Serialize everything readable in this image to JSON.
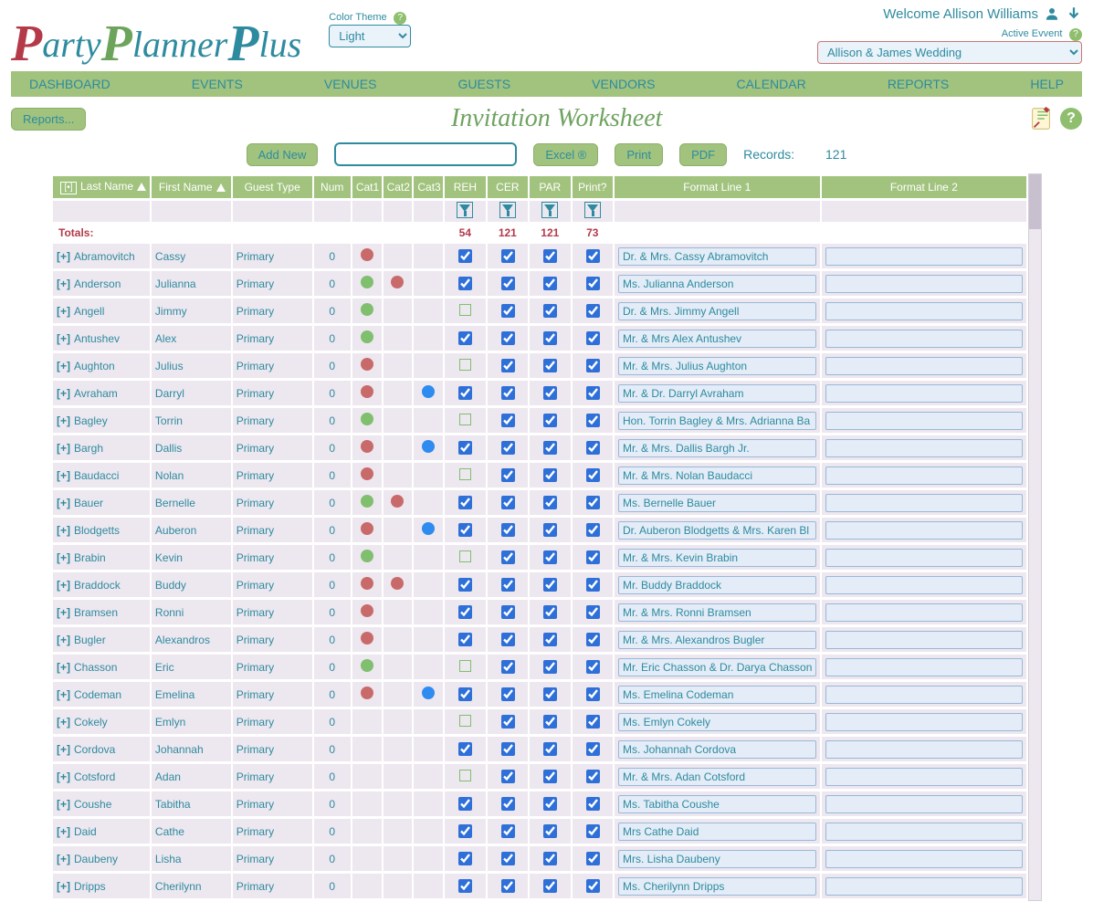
{
  "app": {
    "name_parts": [
      "P",
      "arty",
      "P",
      "lanner",
      "P",
      "lus"
    ],
    "welcome": "Welcome Allison Williams",
    "color_theme_label": "Color Theme",
    "color_theme_value": "Light",
    "active_event_label": "Active Evvent",
    "active_event_value": "Allison & James Wedding"
  },
  "nav": [
    "DASHBOARD",
    "EVENTS",
    "VENUES",
    "GUESTS",
    "VENDORS",
    "CALENDAR",
    "REPORTS",
    "HELP"
  ],
  "subbar": {
    "reports_btn": "Reports..."
  },
  "page_title": "Invitation Worksheet",
  "toolbar": {
    "add_new": "Add New",
    "search_placeholder": "",
    "excel": "Excel ®",
    "print": "Print",
    "pdf": "PDF",
    "records_label": "Records:",
    "records_count": "121"
  },
  "columns": [
    "Last Name",
    "First Name",
    "Guest Type",
    "Num",
    "Cat1",
    "Cat2",
    "Cat3",
    "REH",
    "CER",
    "PAR",
    "Print?",
    "Format Line 1",
    "Format Line 2"
  ],
  "totals": {
    "label": "Totals:",
    "REH": 54,
    "CER": 121,
    "PAR": 121,
    "Print": 73
  },
  "rows": [
    {
      "last": "Abramovitch",
      "first": "Cassy",
      "type": "Primary",
      "num": 0,
      "c1": "red",
      "c2": "",
      "c3": "",
      "reh": true,
      "cer": true,
      "par": true,
      "print": true,
      "f1": "Dr. & Mrs. Cassy Abramovitch"
    },
    {
      "last": "Anderson",
      "first": "Julianna",
      "type": "Primary",
      "num": 0,
      "c1": "green",
      "c2": "red",
      "c3": "",
      "reh": true,
      "cer": true,
      "par": true,
      "print": true,
      "f1": "Ms. Julianna Anderson"
    },
    {
      "last": "Angell",
      "first": "Jimmy",
      "type": "Primary",
      "num": 0,
      "c1": "green",
      "c2": "",
      "c3": "",
      "reh": false,
      "cer": true,
      "par": true,
      "print": true,
      "f1": "Dr. & Mrs. Jimmy Angell"
    },
    {
      "last": "Antushev",
      "first": "Alex",
      "type": "Primary",
      "num": 0,
      "c1": "green",
      "c2": "",
      "c3": "",
      "reh": true,
      "cer": true,
      "par": true,
      "print": true,
      "f1": "Mr. & Mrs Alex Antushev"
    },
    {
      "last": "Aughton",
      "first": "Julius",
      "type": "Primary",
      "num": 0,
      "c1": "red",
      "c2": "",
      "c3": "",
      "reh": false,
      "cer": true,
      "par": true,
      "print": true,
      "f1": "Mr. & Mrs. Julius Aughton"
    },
    {
      "last": "Avraham",
      "first": "Darryl",
      "type": "Primary",
      "num": 0,
      "c1": "red",
      "c2": "",
      "c3": "blue",
      "reh": true,
      "cer": true,
      "par": true,
      "print": true,
      "f1": "Mr. & Dr. Darryl Avraham"
    },
    {
      "last": "Bagley",
      "first": "Torrin",
      "type": "Primary",
      "num": 0,
      "c1": "green",
      "c2": "",
      "c3": "",
      "reh": false,
      "cer": true,
      "par": true,
      "print": true,
      "f1": "Hon. Torrin Bagley & Mrs. Adrianna Ba"
    },
    {
      "last": "Bargh",
      "first": "Dallis",
      "type": "Primary",
      "num": 0,
      "c1": "red",
      "c2": "",
      "c3": "blue",
      "reh": true,
      "cer": true,
      "par": true,
      "print": true,
      "f1": "Mr. & Mrs. Dallis Bargh Jr."
    },
    {
      "last": "Baudacci",
      "first": "Nolan",
      "type": "Primary",
      "num": 0,
      "c1": "red",
      "c2": "",
      "c3": "",
      "reh": false,
      "cer": true,
      "par": true,
      "print": true,
      "f1": "Mr. & Mrs. Nolan Baudacci"
    },
    {
      "last": "Bauer",
      "first": "Bernelle",
      "type": "Primary",
      "num": 0,
      "c1": "green",
      "c2": "red",
      "c3": "",
      "reh": true,
      "cer": true,
      "par": true,
      "print": true,
      "f1": "Ms. Bernelle Bauer"
    },
    {
      "last": "Blodgetts",
      "first": "Auberon",
      "type": "Primary",
      "num": 0,
      "c1": "red",
      "c2": "",
      "c3": "blue",
      "reh": true,
      "cer": true,
      "par": true,
      "print": true,
      "f1": "Dr. Auberon Blodgetts & Mrs. Karen Bl"
    },
    {
      "last": "Brabin",
      "first": "Kevin",
      "type": "Primary",
      "num": 0,
      "c1": "green",
      "c2": "",
      "c3": "",
      "reh": false,
      "cer": true,
      "par": true,
      "print": true,
      "f1": "Mr. & Mrs. Kevin Brabin"
    },
    {
      "last": "Braddock",
      "first": "Buddy",
      "type": "Primary",
      "num": 0,
      "c1": "red",
      "c2": "red",
      "c3": "",
      "reh": true,
      "cer": true,
      "par": true,
      "print": true,
      "f1": "Mr. Buddy Braddock"
    },
    {
      "last": "Bramsen",
      "first": "Ronni",
      "type": "Primary",
      "num": 0,
      "c1": "red",
      "c2": "",
      "c3": "",
      "reh": true,
      "cer": true,
      "par": true,
      "print": true,
      "f1": "Mr. & Mrs. Ronni Bramsen"
    },
    {
      "last": "Bugler",
      "first": "Alexandros",
      "type": "Primary",
      "num": 0,
      "c1": "red",
      "c2": "",
      "c3": "",
      "reh": true,
      "cer": true,
      "par": true,
      "print": true,
      "f1": "Mr. & Mrs. Alexandros Bugler"
    },
    {
      "last": "Chasson",
      "first": "Eric",
      "type": "Primary",
      "num": 0,
      "c1": "green",
      "c2": "",
      "c3": "",
      "reh": false,
      "cer": true,
      "par": true,
      "print": true,
      "f1": "Mr. Eric Chasson & Dr. Darya Chasson"
    },
    {
      "last": "Codeman",
      "first": "Emelina",
      "type": "Primary",
      "num": 0,
      "c1": "red",
      "c2": "",
      "c3": "blue",
      "reh": true,
      "cer": true,
      "par": true,
      "print": true,
      "f1": "Ms. Emelina Codeman"
    },
    {
      "last": "Cokely",
      "first": "Emlyn",
      "type": "Primary",
      "num": 0,
      "c1": "",
      "c2": "",
      "c3": "",
      "reh": false,
      "cer": true,
      "par": true,
      "print": true,
      "f1": "Ms. Emlyn Cokely"
    },
    {
      "last": "Cordova",
      "first": "Johannah",
      "type": "Primary",
      "num": 0,
      "c1": "",
      "c2": "",
      "c3": "",
      "reh": true,
      "cer": true,
      "par": true,
      "print": true,
      "f1": "Ms. Johannah Cordova"
    },
    {
      "last": "Cotsford",
      "first": "Adan",
      "type": "Primary",
      "num": 0,
      "c1": "",
      "c2": "",
      "c3": "",
      "reh": false,
      "cer": true,
      "par": true,
      "print": true,
      "f1": "Mr. & Mrs. Adan Cotsford"
    },
    {
      "last": "Coushe",
      "first": "Tabitha",
      "type": "Primary",
      "num": 0,
      "c1": "",
      "c2": "",
      "c3": "",
      "reh": true,
      "cer": true,
      "par": true,
      "print": true,
      "f1": "Ms. Tabitha Coushe"
    },
    {
      "last": "Daid",
      "first": "Cathe",
      "type": "Primary",
      "num": 0,
      "c1": "",
      "c2": "",
      "c3": "",
      "reh": true,
      "cer": true,
      "par": true,
      "print": true,
      "f1": "Mrs Cathe Daid"
    },
    {
      "last": "Daubeny",
      "first": "Lisha",
      "type": "Primary",
      "num": 0,
      "c1": "",
      "c2": "",
      "c3": "",
      "reh": true,
      "cer": true,
      "par": true,
      "print": true,
      "f1": "Mrs. Lisha Daubeny"
    },
    {
      "last": "Dripps",
      "first": "Cherilynn",
      "type": "Primary",
      "num": 0,
      "c1": "",
      "c2": "",
      "c3": "",
      "reh": true,
      "cer": true,
      "par": true,
      "print": true,
      "f1": "Ms. Cherilynn Dripps"
    }
  ]
}
